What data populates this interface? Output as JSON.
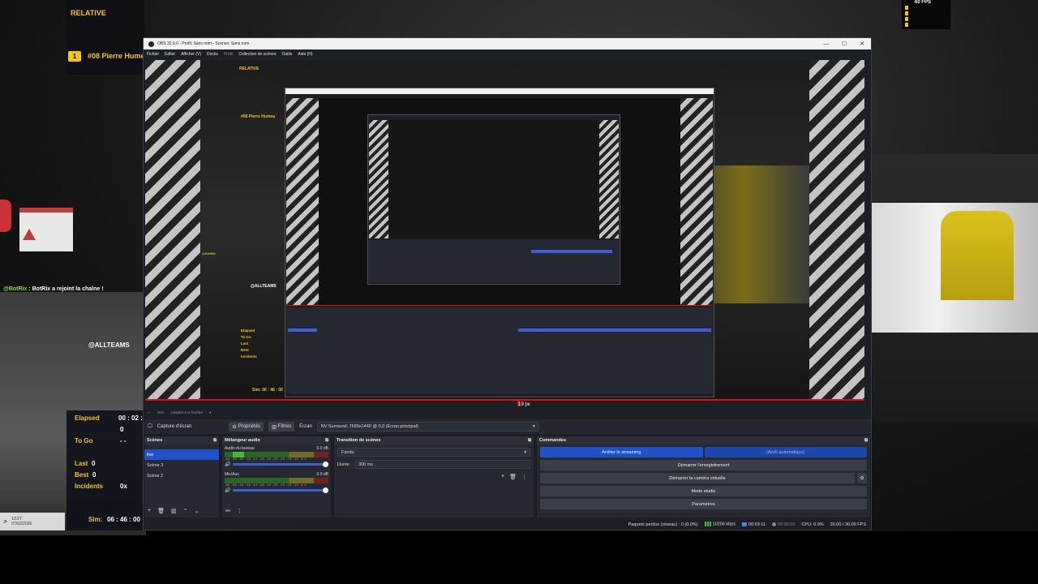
{
  "overlay": {
    "relative_title": "RELATIVE",
    "relative_pos": "1",
    "relative_driver": "#08 Pierre Humea",
    "chat_user": "@BotRix",
    "chat_msg": ": BotRix a rejoint la chaîne !",
    "allteams": "@ALLTEAMS",
    "elapsed_label": "Elapsed",
    "elapsed_val": "00 : 02 :",
    "elapsed_sub": "0",
    "togo_label": "To Go",
    "togo_val": "- -",
    "last_label": "Last",
    "last_val": "0",
    "best_label": "Best",
    "best_val": "0",
    "incidents_label": "Incidents",
    "incidents_val": "0x",
    "sim_label": "Sim:",
    "sim_val": "06 : 46 : 00",
    "fps_text": "60 FPS",
    "taskbar_time": "13:27",
    "taskbar_date": "07/02/2026"
  },
  "obs": {
    "window_title": "OBS 32.0.0 - Profil: Sans nom - Scènes: Sans nom",
    "win_min": "—",
    "win_max": "☐",
    "win_close": "✕",
    "menu": [
      "Fichier",
      "Éditer",
      "Afficher (V)",
      "Docks",
      "Profil",
      "Collection de scènes",
      "Outils",
      "Aide (H)"
    ],
    "px_marker": "19 px",
    "zoom": "35%",
    "zoom_mode": "Adapter à la fenêtre",
    "source_name": "Capture d'écran",
    "props_btn": "Propriétés",
    "filters_btn": "Filtres",
    "screen_label": "Écran",
    "screen_value": "NV Surround: 7680x1440 @ 0,0 (Écran principal)",
    "scenes": {
      "title": "Scènes",
      "items": [
        "live",
        "Scène 3",
        "Scène 2"
      ],
      "active": 0
    },
    "mixer": {
      "title": "Mélangeur audio",
      "tracks": [
        {
          "name": "Audio du bureau",
          "db": "0.0 dB"
        },
        {
          "name": "Mic/Aux",
          "db": "0.0 dB"
        }
      ],
      "ticks": "-60 -55 -50 -45 -40 -35 -30 -25 -20 -15 -10 -5 0"
    },
    "transition": {
      "title": "Transition de scènes",
      "type": "Fondu",
      "duration_label": "Durée",
      "duration": "300 ms"
    },
    "controls": {
      "title": "Commandes",
      "stop_stream": "Arrêter le streaming",
      "auto_stop": "(Arrêt automatique)",
      "start_rec": "Démarrer l'enregistrement",
      "virtual_cam": "Démarrer la caméra virtuelle",
      "studio": "Mode studio",
      "settings": "Paramètres"
    },
    "status": {
      "dropped": "Paquets perdus (réseau) : 0 (0.0%)",
      "bitrate": "10256 kbps",
      "stream_time": "00:03:11",
      "rec_time": "00:00:00",
      "cpu": "CPU: 0.9%",
      "fps": "30.00 / 30.00 FPS"
    }
  },
  "colors": {
    "accent_yellow": "#f2c518",
    "obs_blue": "#1f53c7",
    "chat_green": "#8fd24b",
    "marker_red": "#dd1111"
  }
}
